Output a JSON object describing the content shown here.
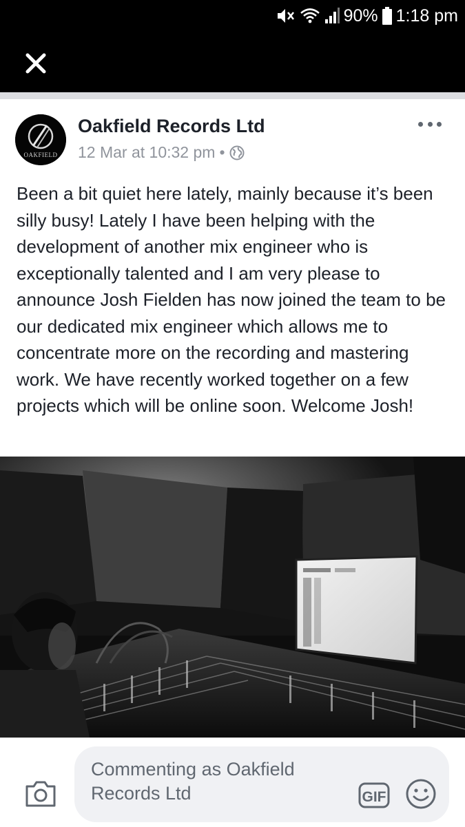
{
  "status_bar": {
    "battery": "90%",
    "time": "1:18 pm",
    "icons": [
      "mute-icon",
      "wifi-icon",
      "signal-icon",
      "battery-icon"
    ]
  },
  "toolbar": {
    "close_icon": "close-icon"
  },
  "post": {
    "page_name": "Oakfield Records Ltd",
    "avatar_text": "OAKFIELD",
    "timestamp": "12 Mar at 10:32 pm",
    "separator": "•",
    "privacy_icon": "globe-icon",
    "more_icon": "more-dots-icon",
    "text": "Been a bit quiet here lately, mainly because it’s been silly busy! Lately I have been helping with the development of another mix engineer who is exceptionally talented and I am very please to announce Josh Fielden has now joined the team to be our dedicated mix engineer which allows me to concentrate more on the recording and mastering work. We have recently worked together on a few projects which will be online soon. Welcome Josh!"
  },
  "comment_bar": {
    "placeholder": "Commenting as Oakfield Records Ltd",
    "camera_icon": "camera-icon",
    "gif_label": "GIF",
    "emoji_icon": "emoji-icon"
  },
  "colors": {
    "header_bg": "#000000",
    "divider": "#dcdde1",
    "text_primary": "#1d2129",
    "text_secondary": "#90949c",
    "input_bg": "#f0f1f4"
  }
}
